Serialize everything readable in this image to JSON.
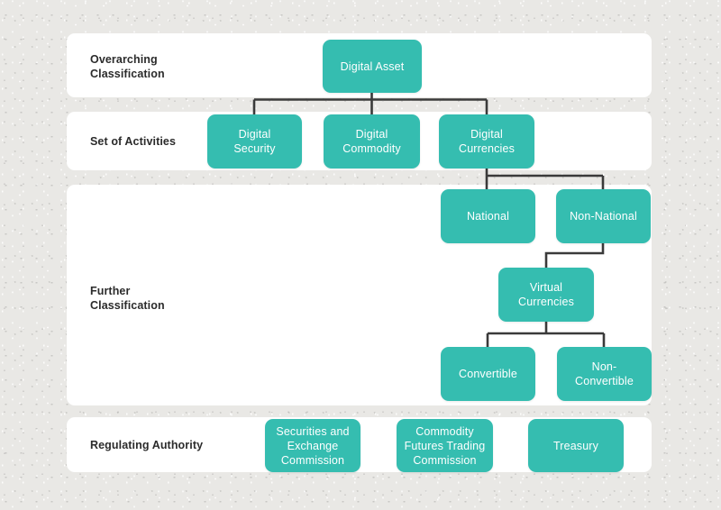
{
  "theme": {
    "node_color": "#35bdb0",
    "panel_color": "#ffffff",
    "background_color": "#e9e8e5",
    "connector_color": "#3a3a3a",
    "label_text_color": "#2b2b2b",
    "node_text_color": "#ffffff"
  },
  "diagram": {
    "type": "hierarchy-tree",
    "rows": [
      {
        "key": "overarching",
        "label": "Overarching\nClassification"
      },
      {
        "key": "activities",
        "label": "Set of Activities"
      },
      {
        "key": "further",
        "label": "Further\nClassification"
      },
      {
        "key": "regulating",
        "label": "Regulating Authority"
      }
    ],
    "nodes": {
      "digital_asset": "Digital Asset",
      "digital_security": "Digital\nSecurity",
      "digital_commodity": "Digital\nCommodity",
      "digital_currencies": "Digital\nCurrencies",
      "national": "National",
      "non_national": "Non-National",
      "virtual_currencies": "Virtual\nCurrencies",
      "convertible": "Convertible",
      "non_convertible": "Non-\nConvertible",
      "sec": "Securities and\nExchange\nCommission",
      "cftc": "Commodity\nFutures Trading\nCommission",
      "treasury": "Treasury"
    },
    "edges": [
      {
        "from": "digital_asset",
        "to": "digital_security"
      },
      {
        "from": "digital_asset",
        "to": "digital_commodity"
      },
      {
        "from": "digital_asset",
        "to": "digital_currencies"
      },
      {
        "from": "digital_currencies",
        "to": "national"
      },
      {
        "from": "digital_currencies",
        "to": "non_national"
      },
      {
        "from": "non_national",
        "to": "virtual_currencies"
      },
      {
        "from": "virtual_currencies",
        "to": "convertible"
      },
      {
        "from": "virtual_currencies",
        "to": "non_convertible"
      }
    ]
  }
}
